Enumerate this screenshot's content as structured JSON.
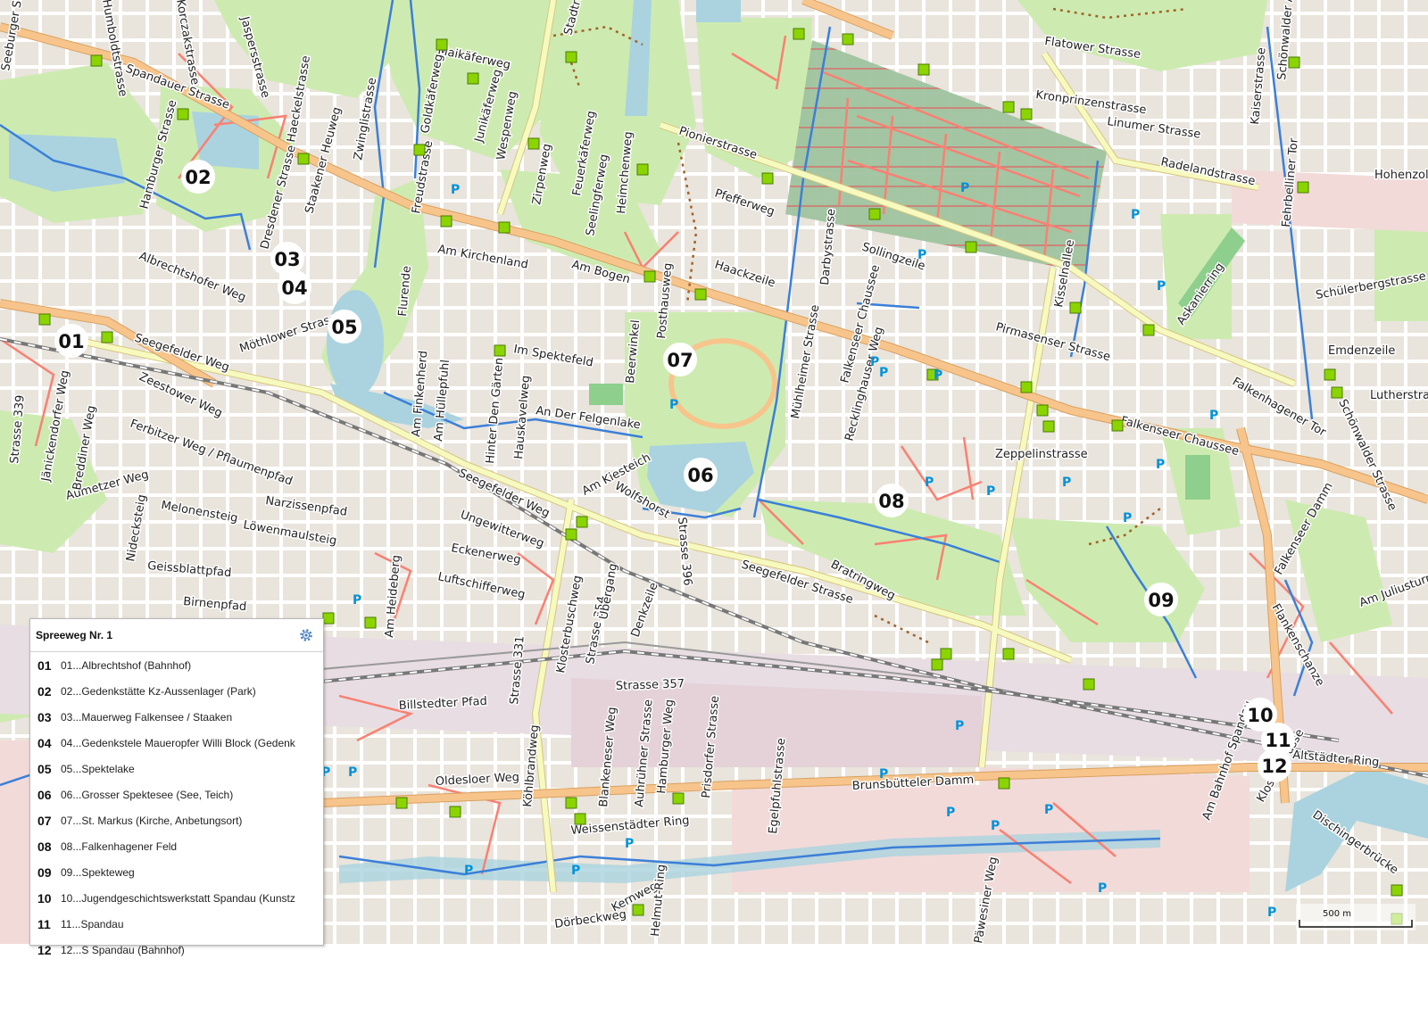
{
  "legend": {
    "title": "Spreeweg Nr. 1",
    "settings_icon": "gear-icon",
    "items": [
      {
        "num": "01",
        "label": "01...Albrechtshof (Bahnhof)"
      },
      {
        "num": "02",
        "label": "02...Gedenkstätte Kz-Aussenlager (Park)"
      },
      {
        "num": "03",
        "label": "03...Mauerweg Falkensee / Staaken"
      },
      {
        "num": "04",
        "label": "04...Gedenkstele Maueropfer Willi Block (Gedenk"
      },
      {
        "num": "05",
        "label": "05...Spektelake"
      },
      {
        "num": "06",
        "label": "06...Grosser Spektesee (See, Teich)"
      },
      {
        "num": "07",
        "label": "07...St. Markus (Kirche, Anbetungsort)"
      },
      {
        "num": "08",
        "label": "08...Falkenhagener Feld"
      },
      {
        "num": "09",
        "label": "09...Spekteweg"
      },
      {
        "num": "10",
        "label": "10...Jugendgeschichtswerkstatt Spandau (Kunstz"
      },
      {
        "num": "11",
        "label": "11...Spandau"
      },
      {
        "num": "12",
        "label": "12...S Spandau (Bahnhof)"
      }
    ]
  },
  "map": {
    "scale_label": "500 m",
    "colors": {
      "background": "#e9e4dc",
      "park": "#cdebb0",
      "cemetery": "#aacbaf",
      "water": "#aad3df",
      "railway_area": "#e6d5dc",
      "commercial": "#f2dad9",
      "main_road": "#f7c58c",
      "secondary_road": "#f7fabf",
      "path": "#fa8072",
      "waterway": "#3b7fd8",
      "bus_stop": "#8bd400"
    },
    "markers": [
      "01",
      "02",
      "03",
      "04",
      "05",
      "06",
      "07",
      "08",
      "09",
      "10",
      "11",
      "12"
    ],
    "street_labels": [
      "Spandauer Strasse",
      "Hamburger Strasse",
      "Dresdener Strasse",
      "Staakener Heuweg",
      "Zwinglistrasse",
      "Freudstrasse",
      "Goldkäferweg",
      "Maikäferweg",
      "Junikäferweg",
      "Wespenweg",
      "Zirpenweg",
      "Feuerkäferweg",
      "Seelingferweg",
      "Heimchenweg",
      "Stadtrandstrasse",
      "Pionierstrasse",
      "Pfefferweg",
      "Haackzeile",
      "Darbystrasse",
      "Sollingzeile",
      "Flatower Strasse",
      "Kronprinzenstrasse",
      "Linumer Strasse",
      "Radelandstrasse",
      "Hohenzollernring",
      "Kisselnallee",
      "Kaiserstrasse",
      "Schönwalder Allee",
      "Fehrbelliner Tor",
      "Askanierring",
      "Schülerbergstrasse",
      "Emdenzeile",
      "Lutherstrasse",
      "Schönwalder Strasse",
      "Falkenhagener Tor",
      "Pirmasenser Strasse",
      "Falkenseer Chaussee",
      "Zeppelinstrasse",
      "Mühlheimer Strasse",
      "Falkenseer Chaussee",
      "Recklinghauser Weg",
      "Am Kirchenland",
      "Am Bogen",
      "Albrechtshofer Weg",
      "Möthlower Strasse",
      "Seegefelder Weg",
      "Zeestower Weg",
      "Ferbitzer Weg / Pflaumenpfad",
      "Aumetzer Weg",
      "Melonensteig",
      "Narzissenpfad",
      "Löwenmaulsteig",
      "Geissblattpfad",
      "Birnenpfad",
      "Nidecksteig",
      "Jänickendorfer Weg",
      "Breddiner Weg",
      "Strasse 339",
      "Im Spektefeld",
      "An Der Felgenlake",
      "Am Kiesteich",
      "Wolfshorst",
      "Strasse 396",
      "Ungewitterweg",
      "Eckenerweg",
      "Luftschifferweg",
      "Seegefelder Weg",
      "Seegefelder Strasse",
      "Bratringweg",
      "Falkenseer Damm",
      "Am Juliusturm",
      "Am Bahnhof Spandau",
      "Flankenschanze",
      "Altstädter Ring",
      "Klosterstrasse",
      "Dischingerbrücke",
      "Brunsbütteler Damm",
      "Strasse 357",
      "Billstedter Pfad",
      "Oldesloer Weg",
      "Weissenstädter Ring",
      "Köhlbrandweg",
      "Blankeneser Weg",
      "Auhrühner Strasse",
      "Hamburger Weg",
      "Prisdorfer Strasse",
      "Egelpfuhlstrasse",
      "Päwesiner Weg",
      "Dörbeckweg",
      "Kernweg",
      "Helmut-Ring",
      "Am Heideberg",
      "Strasse 331",
      "Klosterbuschweg",
      "Strasse 354",
      "Übergang",
      "Denkzeile",
      "Posthausweg",
      "Beerwinkel",
      "Hauskavelweg",
      "Hinter Den Gärten",
      "Am Hüllepfuhl",
      "Am Finkenherd",
      "Flurende",
      "Haeckelstrasse",
      "Jaspersstrasse",
      "Korczakstrasse",
      "Humboldtstrasse",
      "Seeburger Strasse"
    ]
  }
}
